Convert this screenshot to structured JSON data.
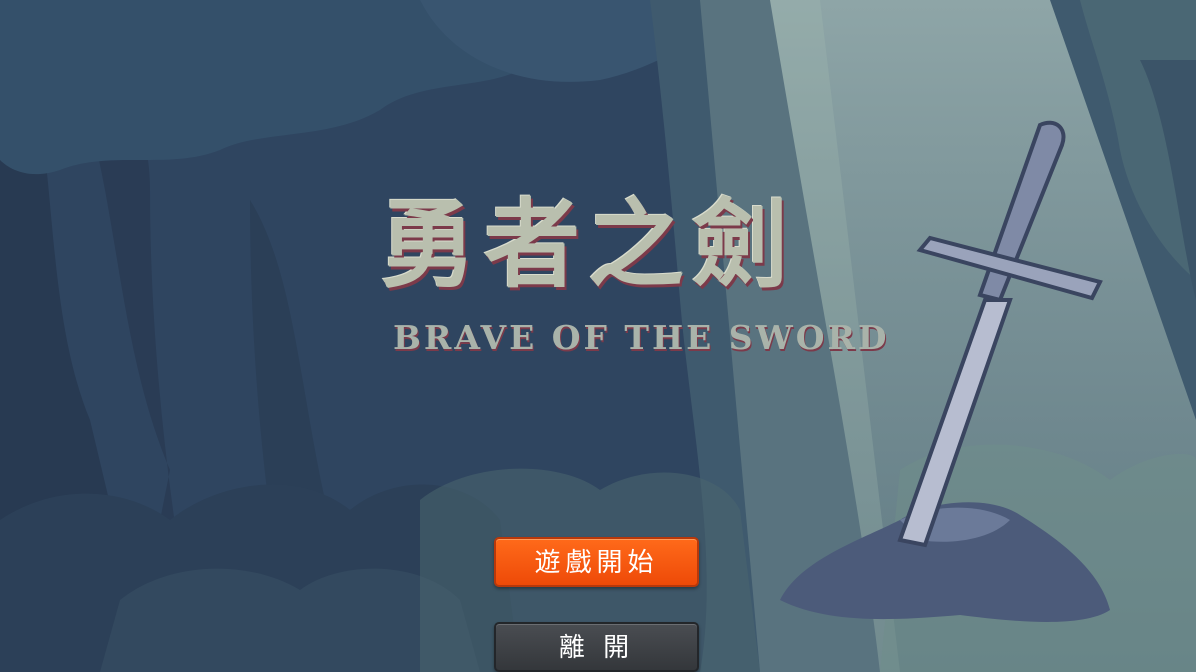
{
  "game": {
    "title_cn": "勇者之劍",
    "title_en": "BRAVE OF THE SWORD"
  },
  "menu": {
    "start_label": "遊戲開始",
    "exit_label": "離 開"
  },
  "colors": {
    "start_button": "#f2530f",
    "exit_button": "#3d4045",
    "background": "#2f4560",
    "light_beam": "#9fb7ad"
  }
}
